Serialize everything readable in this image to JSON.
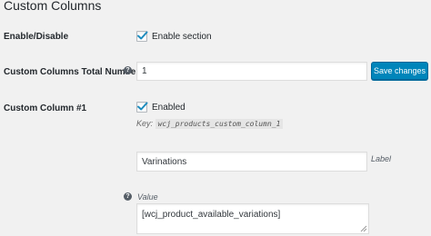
{
  "section_title": "Custom Columns",
  "rows": {
    "enable_disable": {
      "label": "Enable/Disable",
      "checkbox_label": "Enable section",
      "checked": true
    },
    "total_number": {
      "label": "Custom Columns Total Number",
      "value": "1",
      "save_label": "Save changes"
    },
    "column_1": {
      "label": "Custom Column #1",
      "checkbox_label": "Enabled",
      "checked": true,
      "key_prefix": "Key:",
      "key_code": "wcj_products_custom_column_1",
      "label_field_value": "Varinations",
      "label_field_caption": "Label",
      "value_caption": "Value",
      "value_field_value": "[wcj_product_available_variations]"
    }
  },
  "icons": {
    "help": "help-icon",
    "check": "checkmark-icon",
    "resize": "resize-handle-icon"
  },
  "colors": {
    "accent": "#0085ba",
    "check": "#1e8cbe",
    "background": "#f1f1f1"
  }
}
